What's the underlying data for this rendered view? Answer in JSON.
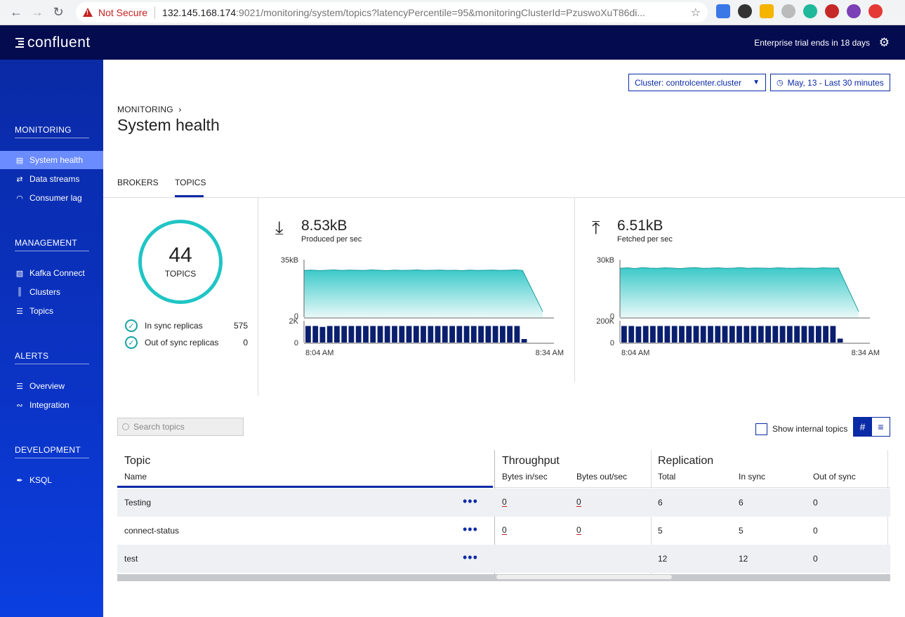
{
  "browser": {
    "not_secure": "Not Secure",
    "url_host": "132.145.168.174",
    "url_rest": ":9021/monitoring/system/topics?latencyPercentile=95&monitoringClusterId=PzuswoXuT86di..."
  },
  "header": {
    "logo_text": "confluent",
    "trial_text": "Enterprise trial ends in 18 days"
  },
  "sidebar": {
    "sections": [
      {
        "title": "MONITORING",
        "items": [
          {
            "label": "System health",
            "icon": "chart-icon",
            "active": true
          },
          {
            "label": "Data streams",
            "icon": "streams-icon"
          },
          {
            "label": "Consumer lag",
            "icon": "gauge-icon"
          }
        ]
      },
      {
        "title": "MANAGEMENT",
        "items": [
          {
            "label": "Kafka Connect",
            "icon": "connect-icon"
          },
          {
            "label": "Clusters",
            "icon": "clusters-icon"
          },
          {
            "label": "Topics",
            "icon": "topics-icon"
          }
        ]
      },
      {
        "title": "ALERTS",
        "items": [
          {
            "label": "Overview",
            "icon": "list-icon"
          },
          {
            "label": "Integration",
            "icon": "integration-icon"
          }
        ]
      },
      {
        "title": "DEVELOPMENT",
        "items": [
          {
            "label": "KSQL",
            "icon": "ksql-icon"
          }
        ]
      }
    ]
  },
  "toolbar": {
    "cluster_label": "Cluster: controlcenter.cluster",
    "time_label": "May, 13 - Last 30 minutes"
  },
  "page": {
    "breadcrumb": "MONITORING",
    "title": "System health",
    "tabs": [
      {
        "label": "BROKERS"
      },
      {
        "label": "TOPICS",
        "active": true
      }
    ]
  },
  "summary": {
    "topics_count": "44",
    "topics_label": "TOPICS",
    "in_sync_label": "In sync replicas",
    "in_sync_value": "575",
    "out_sync_label": "Out of sync replicas",
    "out_sync_value": "0"
  },
  "produced": {
    "value": "8.53kB",
    "label": "Produced per sec"
  },
  "fetched": {
    "value": "6.51kB",
    "label": "Fetched per sec"
  },
  "chart_data": [
    {
      "type": "area",
      "title": "Produced per sec",
      "ylim_labels": [
        "0",
        "35kB"
      ],
      "x_start": "8:04 AM",
      "x_end": "8:34 AM",
      "values": [
        28.5,
        28.7,
        28.4,
        28.6,
        28.8,
        28.5,
        28.7,
        28.6,
        28.5,
        28.8,
        28.6,
        28.4,
        28.7,
        28.5,
        28.6,
        28.8,
        28.5,
        28.6,
        28.7,
        28.5,
        28.6,
        28.4,
        28.7,
        28.5,
        28.6,
        28.7,
        28.5,
        28.6,
        28.8,
        28.5,
        3.5
      ],
      "ymax": 35
    },
    {
      "type": "bar",
      "title": "Produced per sec (count)",
      "ylim_labels": [
        "0",
        "2K"
      ],
      "values": [
        1.9,
        1.9,
        1.8,
        1.9,
        1.9,
        1.9,
        1.9,
        1.9,
        1.9,
        1.9,
        1.9,
        1.9,
        1.9,
        1.9,
        1.9,
        1.9,
        1.9,
        1.9,
        1.9,
        1.9,
        1.9,
        1.9,
        1.9,
        1.9,
        1.9,
        1.9,
        1.9,
        1.9,
        1.9,
        1.9,
        0.4
      ],
      "ymax": 2.5
    },
    {
      "type": "area",
      "title": "Fetched per sec",
      "ylim_labels": [
        "0",
        "30kB"
      ],
      "x_start": "8:04 AM",
      "x_end": "8:34 AM",
      "values": [
        25.5,
        25.8,
        25.4,
        25.9,
        25.6,
        25.5,
        25.8,
        25.6,
        25.4,
        25.7,
        25.9,
        25.5,
        25.6,
        25.8,
        25.5,
        25.6,
        25.9,
        25.5,
        25.7,
        25.6,
        25.5,
        25.8,
        25.6,
        25.5,
        25.7,
        25.6,
        25.5,
        25.8,
        25.6,
        25.7,
        3.0
      ],
      "ymax": 30
    },
    {
      "type": "bar",
      "title": "Fetched per sec (count)",
      "ylim_labels": [
        "0",
        "200K"
      ],
      "values": [
        190,
        190,
        185,
        190,
        190,
        190,
        190,
        190,
        190,
        190,
        190,
        190,
        190,
        190,
        190,
        190,
        190,
        190,
        190,
        190,
        190,
        190,
        190,
        190,
        190,
        190,
        190,
        190,
        190,
        190,
        45
      ],
      "ymax": 250
    }
  ],
  "controls": {
    "search_placeholder": "Search topics",
    "show_internal": "Show internal topics"
  },
  "table": {
    "groups": [
      "Topic",
      "Throughput",
      "Replication"
    ],
    "columns": [
      "Name",
      "Bytes in/sec",
      "Bytes out/sec",
      "Total",
      "In sync",
      "Out of sync"
    ],
    "rows": [
      {
        "name": "Testing",
        "bytes_in": "0",
        "bytes_out": "0",
        "total": "6",
        "in_sync": "6",
        "out_sync": "0"
      },
      {
        "name": "connect-status",
        "bytes_in": "0",
        "bytes_out": "0",
        "total": "5",
        "in_sync": "5",
        "out_sync": "0"
      },
      {
        "name": "test",
        "bytes_in": "",
        "bytes_out": "",
        "total": "12",
        "in_sync": "12",
        "out_sync": "0"
      }
    ]
  }
}
